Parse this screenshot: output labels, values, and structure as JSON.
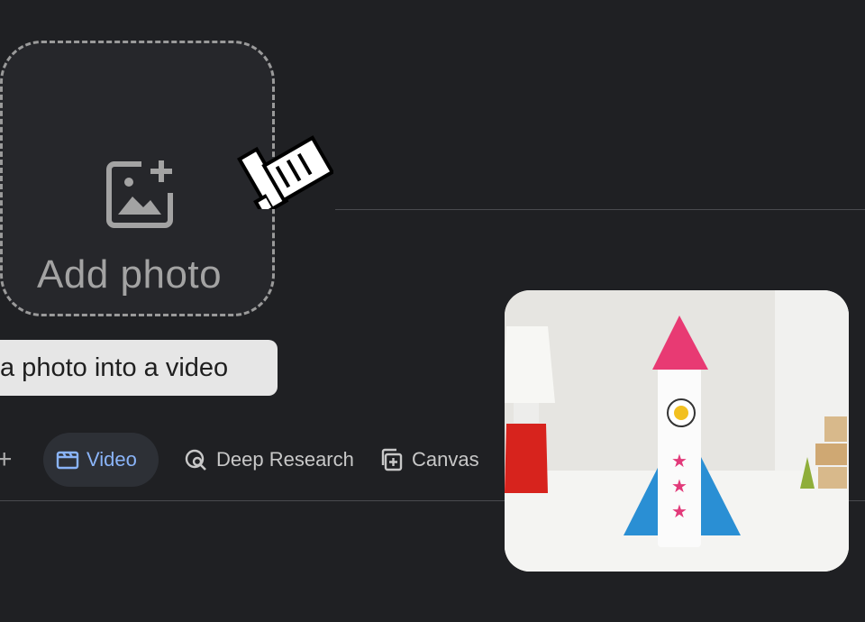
{
  "upload": {
    "label": "Add photo",
    "icon": "add-image-icon"
  },
  "tooltip": {
    "text": "a photo into a video"
  },
  "toolbar": {
    "plus_icon": "plus-icon",
    "video_label": "Video",
    "deep_research_label": "Deep Research",
    "canvas_label": "Canvas"
  },
  "colors": {
    "background": "#1f2023",
    "accent": "#8ab4f8",
    "tooltip_bg": "#e6e6e6"
  },
  "preview": {
    "icon": "rocket-photo"
  }
}
